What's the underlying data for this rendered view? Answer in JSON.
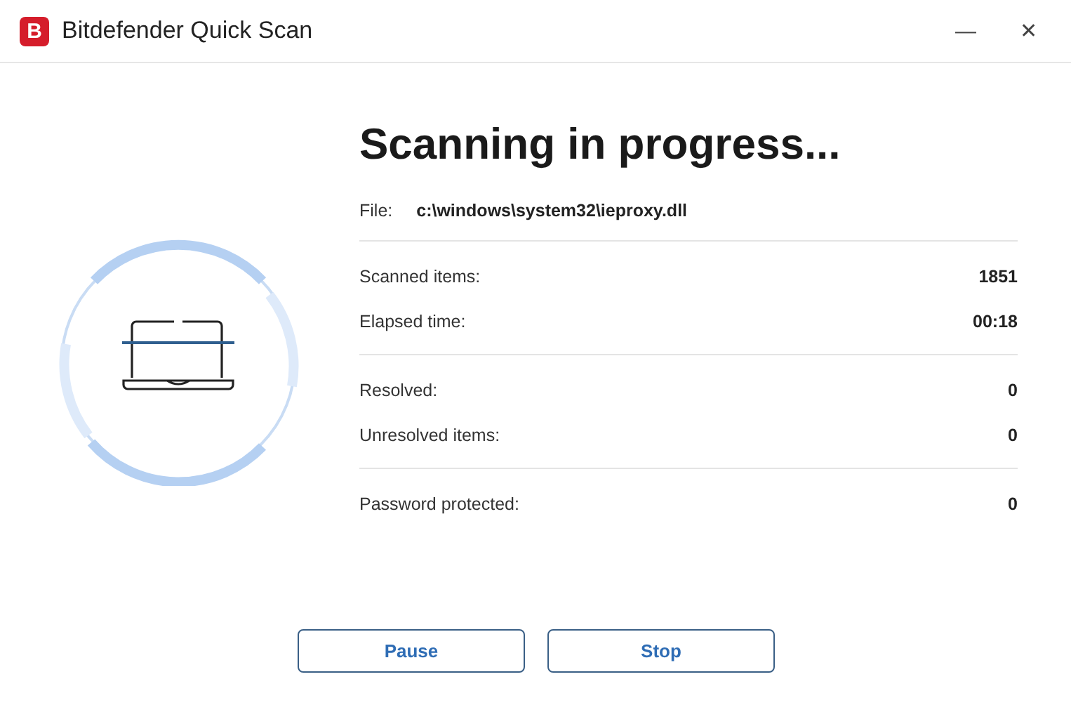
{
  "window": {
    "logo_letter": "B",
    "title": "Bitdefender Quick Scan",
    "minimize": "—",
    "close": "✕"
  },
  "heading": "Scanning in progress...",
  "file": {
    "label": "File:",
    "value": "c:\\windows\\system32\\ieproxy.dll"
  },
  "stat_groups": [
    [
      {
        "label": "Scanned items:",
        "value": "1851"
      },
      {
        "label": "Elapsed time:",
        "value": "00:18"
      }
    ],
    [
      {
        "label": "Resolved:",
        "value": "0"
      },
      {
        "label": "Unresolved items:",
        "value": "0"
      }
    ],
    [
      {
        "label": "Password protected:",
        "value": "0"
      }
    ]
  ],
  "buttons": [
    "Pause",
    "Stop"
  ]
}
